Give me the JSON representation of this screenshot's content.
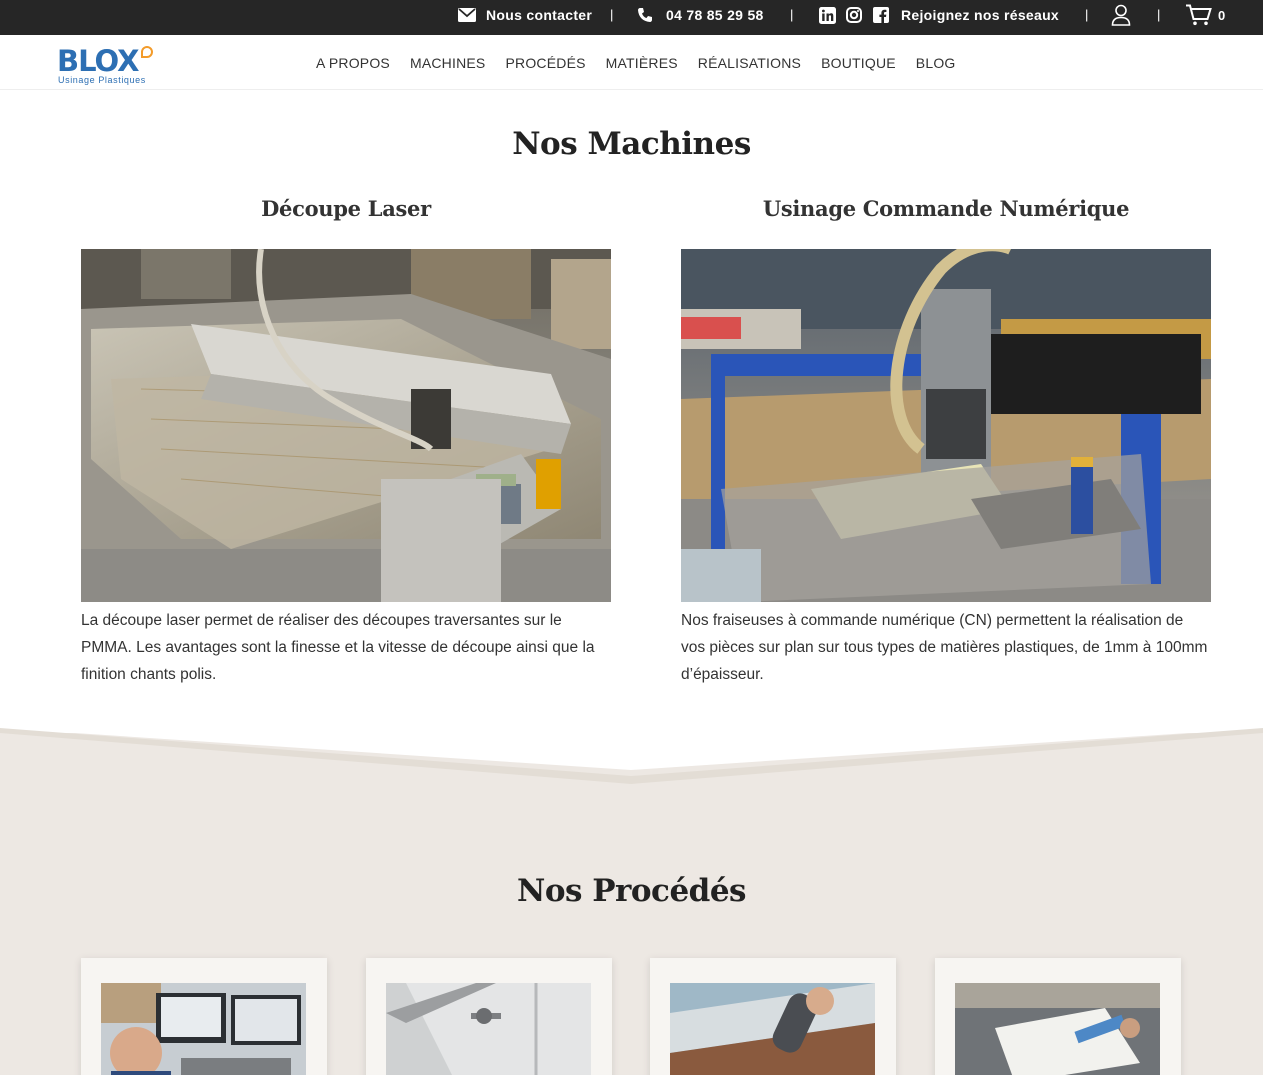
{
  "topbar": {
    "contact_label": "Nous contacter",
    "phone": "04 78 85 29 58",
    "social_label": "Rejoignez nos réseaux",
    "cart_count": "0",
    "separator": "|"
  },
  "logo": {
    "brand": "BLOX",
    "tagline": "Usinage Plastiques"
  },
  "nav": {
    "items": [
      "A PROPOS",
      "MACHINES",
      "PROCÉDÉS",
      "MATIÈRES",
      "RÉALISATIONS",
      "BOUTIQUE",
      "BLOG"
    ]
  },
  "machines": {
    "title": "Nos Machines",
    "items": [
      {
        "title": "Découpe Laser",
        "text": "La découpe laser permet de réaliser des découpes traversantes sur le PMMA. Les avantages sont la finesse et la vitesse de découpe ainsi que la finition chants polis."
      },
      {
        "title": "Usinage Commande Numérique",
        "text": "Nos fraiseuses à commande numérique (CN) permettent la réalisation de vos pièces sur plan sur tous types de matières plastiques, de 1mm à 100mm d’épaisseur."
      }
    ]
  },
  "procedes": {
    "title": "Nos Procédés"
  },
  "colors": {
    "topbar_bg": "#262626",
    "brand_blue": "#2d6fb3",
    "brand_orange": "#f39b2a",
    "section_beige": "#ede8e3"
  },
  "icons": [
    "envelope-icon",
    "phone-icon",
    "linkedin-icon",
    "instagram-icon",
    "facebook-icon",
    "user-icon",
    "cart-icon"
  ]
}
